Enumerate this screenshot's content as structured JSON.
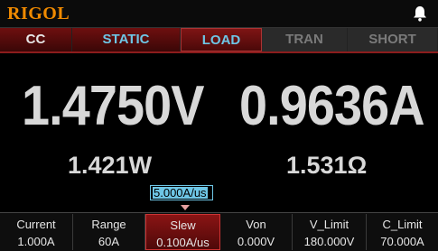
{
  "brand": "RIGOL",
  "icons": {
    "notification": "bell-icon"
  },
  "tabs": [
    {
      "label": "CC",
      "state": "normal"
    },
    {
      "label": "STATIC",
      "state": "normal"
    },
    {
      "label": "LOAD",
      "state": "selected"
    },
    {
      "label": "TRAN",
      "state": "disabled"
    },
    {
      "label": "SHORT",
      "state": "disabled"
    }
  ],
  "readings": {
    "voltage": "1.4750V",
    "current": "0.9636A",
    "power": "1.421W",
    "resistance": "1.531Ω"
  },
  "edit_popup": {
    "value": "5.000A/us"
  },
  "params": [
    {
      "label": "Current",
      "value": "1.000A"
    },
    {
      "label": "Range",
      "value": "60A"
    },
    {
      "label": "Slew",
      "value": "0.100A/us",
      "selected": true
    },
    {
      "label": "Von",
      "value": "0.000V"
    },
    {
      "label": "V_Limit",
      "value": "180.000V"
    },
    {
      "label": "C_Limit",
      "value": "70.000A"
    }
  ],
  "colors": {
    "brand": "#f08a00",
    "accent_cyan": "#6ec6e6",
    "active_red": "#8a1414",
    "text": "#d8d8d8"
  }
}
